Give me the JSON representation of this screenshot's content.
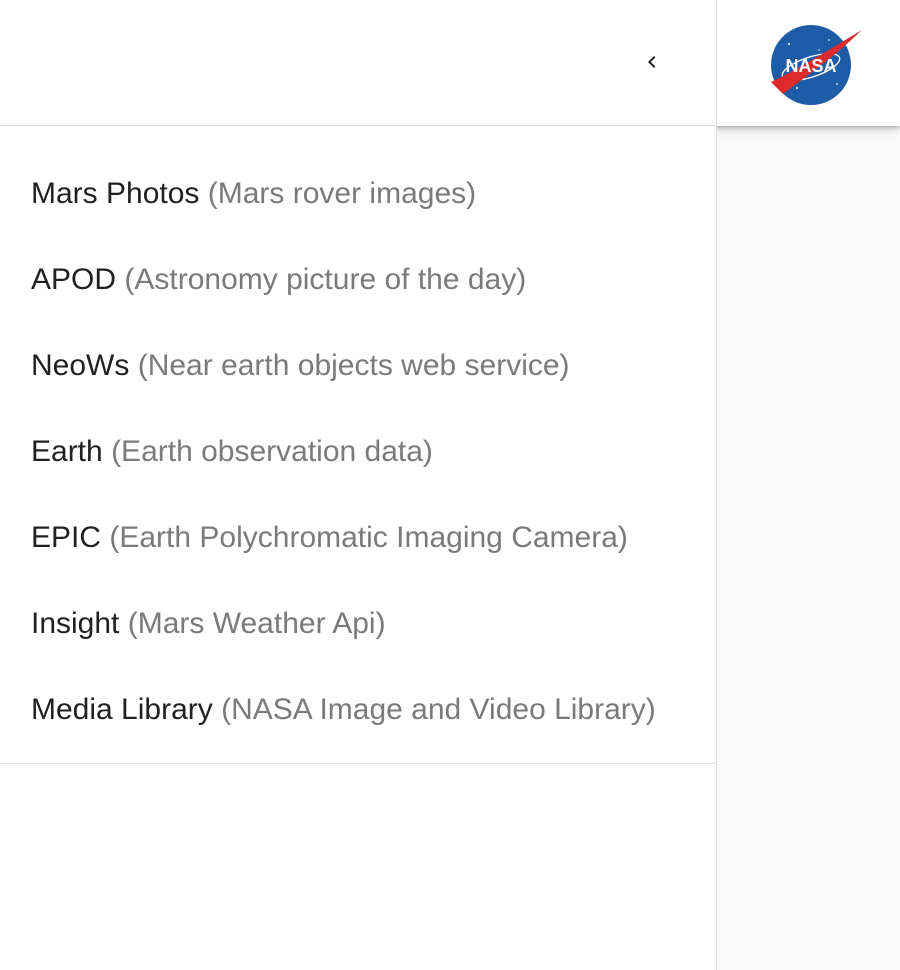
{
  "appbar": {
    "logo_text": "NASA",
    "logo_colors": {
      "disc": "#1f5ca8",
      "chevron": "#dd2a2a",
      "text": "#ffffff"
    }
  },
  "drawer": {
    "close_icon": "chevron-left-icon",
    "items": [
      {
        "title": "Mars Photos",
        "description": "(Mars rover images)"
      },
      {
        "title": "APOD",
        "description": "(Astronomy picture of the day)"
      },
      {
        "title": "NeoWs",
        "description": "(Near earth objects web service)"
      },
      {
        "title": "Earth",
        "description": "(Earth observation data)"
      },
      {
        "title": "EPIC",
        "description": "(Earth Polychromatic Imaging Camera)"
      },
      {
        "title": "Insight",
        "description": "(Mars Weather Api)"
      },
      {
        "title": "Media Library",
        "description": "(NASA Image and Video Library)"
      }
    ]
  }
}
